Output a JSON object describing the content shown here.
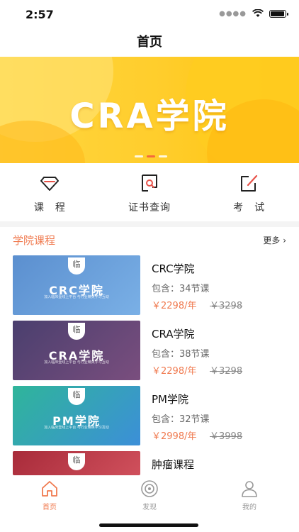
{
  "status_bar": {
    "time": "2:57"
  },
  "header": {
    "title": "首页"
  },
  "banner": {
    "title": "CRA学院"
  },
  "quick_nav": [
    {
      "label": "课　程"
    },
    {
      "label": "证书查询"
    },
    {
      "label": "考　试"
    }
  ],
  "section": {
    "title": "学院课程",
    "more": "更多 ›"
  },
  "courses": [
    {
      "name": "CRC学院",
      "count": "包含：34节课",
      "price": "￥2298/年",
      "original": "￥3298",
      "thumb_badge": "临",
      "thumb_title": "CRC学院",
      "thumb_sub": "加入临床壹线上平台 与行业精英学习互动"
    },
    {
      "name": "CRA学院",
      "count": "包含：38节课",
      "price": "￥2298/年",
      "original": "￥3298",
      "thumb_badge": "临",
      "thumb_title": "CRA学院",
      "thumb_sub": "加入临床壹线上平台 与行业精英学习互动"
    },
    {
      "name": "PM学院",
      "count": "包含：32节课",
      "price": "￥2998/年",
      "original": "￥3998",
      "thumb_badge": "临",
      "thumb_title": "PM学院",
      "thumb_sub": "加入临床壹线上平台 与行业精英学习互动"
    },
    {
      "name": "肿瘤课程",
      "thumb_badge": "临"
    }
  ],
  "tab_bar": [
    {
      "label": "首页",
      "active": true
    },
    {
      "label": "发现",
      "active": false
    },
    {
      "label": "我的",
      "active": false
    }
  ],
  "colors": {
    "accent": "#f07a4f",
    "banner_yellow": "#ffcd2b"
  }
}
